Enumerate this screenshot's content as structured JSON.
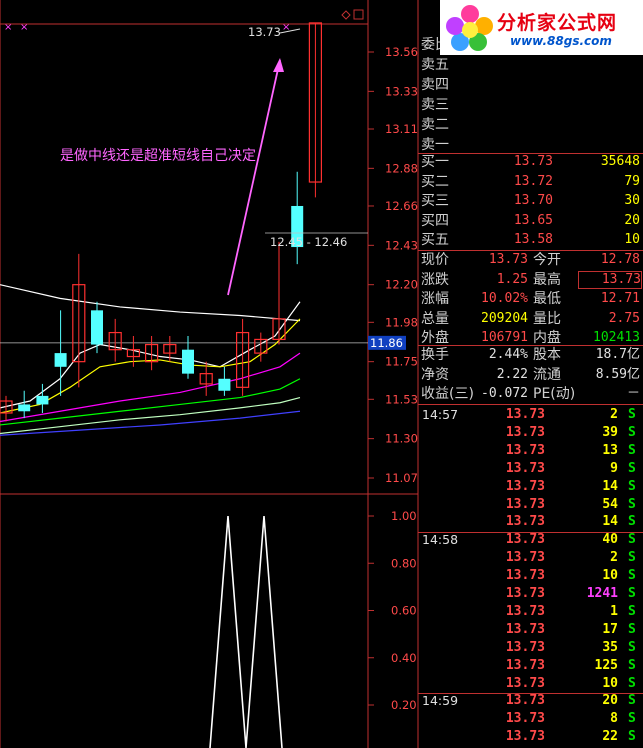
{
  "watermark": {
    "title": "分析家公式网",
    "url": "www.88gs.com"
  },
  "price_axis": [
    "13.56",
    "13.33",
    "13.11",
    "12.88",
    "12.66",
    "12.43",
    "12.20",
    "11.98",
    "11.75",
    "11.53",
    "11.30",
    "11.07"
  ],
  "current_price_tag": "11.86",
  "indicator_axis": [
    "1.00",
    "0.80",
    "0.60",
    "0.40",
    "0.20"
  ],
  "annotation": "是做中线还是超准短线自己决定",
  "high_label": "13.73",
  "range_label": "12.45 - 12.46",
  "order_book": {
    "header": "委比",
    "asks": [
      {
        "label": "卖五",
        "price": "",
        "vol": ""
      },
      {
        "label": "卖四",
        "price": "",
        "vol": ""
      },
      {
        "label": "卖三",
        "price": "",
        "vol": ""
      },
      {
        "label": "卖二",
        "price": "",
        "vol": ""
      },
      {
        "label": "卖一",
        "price": "",
        "vol": ""
      }
    ],
    "bids": [
      {
        "label": "买一",
        "price": "13.73",
        "vol": "35648"
      },
      {
        "label": "买二",
        "price": "13.72",
        "vol": "79"
      },
      {
        "label": "买三",
        "price": "13.70",
        "vol": "30"
      },
      {
        "label": "买四",
        "price": "13.65",
        "vol": "20"
      },
      {
        "label": "买五",
        "price": "13.58",
        "vol": "10"
      }
    ]
  },
  "quote": [
    {
      "l1": "现价",
      "v1": "13.73",
      "c1": "red",
      "l2": "今开",
      "v2": "12.78",
      "c2": "red",
      "box": false
    },
    {
      "l1": "涨跌",
      "v1": "1.25",
      "c1": "red",
      "l2": "最高",
      "v2": "13.73",
      "c2": "red",
      "box": true
    },
    {
      "l1": "涨幅",
      "v1": "10.02%",
      "c1": "red",
      "l2": "最低",
      "v2": "12.71",
      "c2": "red",
      "box": false
    },
    {
      "l1": "总量",
      "v1": "209204",
      "c1": "yellow",
      "l2": "量比",
      "v2": "2.75",
      "c2": "red",
      "box": false
    },
    {
      "l1": "外盘",
      "v1": "106791",
      "c1": "red",
      "l2": "内盘",
      "v2": "102413",
      "c2": "green",
      "box": false
    }
  ],
  "fundamentals": [
    {
      "l1": "换手",
      "v1": "2.44%",
      "l2": "股本",
      "v2": "18.7亿"
    },
    {
      "l1": "净资",
      "v1": "2.22",
      "l2": "流通",
      "v2": "8.59亿"
    },
    {
      "l1": "收益(三)",
      "v1": "-0.072",
      "l2": "PE(动)",
      "v2": "－"
    }
  ],
  "ticks": [
    {
      "time": "14:57",
      "price": "13.73",
      "vol": "2",
      "side": "S",
      "vc": "yellow"
    },
    {
      "time": "",
      "price": "13.73",
      "vol": "39",
      "side": "S",
      "vc": "yellow"
    },
    {
      "time": "",
      "price": "13.73",
      "vol": "13",
      "side": "S",
      "vc": "yellow"
    },
    {
      "time": "",
      "price": "13.73",
      "vol": "9",
      "side": "S",
      "vc": "yellow"
    },
    {
      "time": "",
      "price": "13.73",
      "vol": "14",
      "side": "S",
      "vc": "yellow"
    },
    {
      "time": "",
      "price": "13.73",
      "vol": "54",
      "side": "S",
      "vc": "yellow"
    },
    {
      "time": "",
      "price": "13.73",
      "vol": "14",
      "side": "S",
      "vc": "yellow"
    },
    {
      "time": "14:58",
      "price": "13.73",
      "vol": "40",
      "side": "S",
      "vc": "yellow"
    },
    {
      "time": "",
      "price": "13.73",
      "vol": "2",
      "side": "S",
      "vc": "yellow"
    },
    {
      "time": "",
      "price": "13.73",
      "vol": "10",
      "side": "S",
      "vc": "yellow"
    },
    {
      "time": "",
      "price": "13.73",
      "vol": "1241",
      "side": "S",
      "vc": "magenta"
    },
    {
      "time": "",
      "price": "13.73",
      "vol": "1",
      "side": "S",
      "vc": "yellow"
    },
    {
      "time": "",
      "price": "13.73",
      "vol": "17",
      "side": "S",
      "vc": "yellow"
    },
    {
      "time": "",
      "price": "13.73",
      "vol": "35",
      "side": "S",
      "vc": "yellow"
    },
    {
      "time": "",
      "price": "13.73",
      "vol": "125",
      "side": "S",
      "vc": "yellow"
    },
    {
      "time": "",
      "price": "13.73",
      "vol": "10",
      "side": "S",
      "vc": "yellow"
    },
    {
      "time": "14:59",
      "price": "13.73",
      "vol": "20",
      "side": "S",
      "vc": "yellow"
    },
    {
      "time": "",
      "price": "13.73",
      "vol": "8",
      "side": "S",
      "vc": "yellow"
    },
    {
      "time": "",
      "price": "13.73",
      "vol": "22",
      "side": "S",
      "vc": "yellow"
    }
  ],
  "candles": [
    {
      "o": 11.45,
      "c": 11.52,
      "h": 11.55,
      "l": 11.4
    },
    {
      "o": 11.5,
      "c": 11.46,
      "h": 11.58,
      "l": 11.42
    },
    {
      "o": 11.55,
      "c": 11.5,
      "h": 11.62,
      "l": 11.45
    },
    {
      "o": 11.8,
      "c": 11.72,
      "h": 12.05,
      "l": 11.55
    },
    {
      "o": 11.75,
      "c": 12.2,
      "h": 12.38,
      "l": 11.6
    },
    {
      "o": 12.05,
      "c": 11.85,
      "h": 12.1,
      "l": 11.8
    },
    {
      "o": 11.82,
      "c": 11.92,
      "h": 12.0,
      "l": 11.75
    },
    {
      "o": 11.78,
      "c": 11.82,
      "h": 11.9,
      "l": 11.72
    },
    {
      "o": 11.75,
      "c": 11.85,
      "h": 11.9,
      "l": 11.7
    },
    {
      "o": 11.8,
      "c": 11.85,
      "h": 11.9,
      "l": 11.75
    },
    {
      "o": 11.82,
      "c": 11.68,
      "h": 11.9,
      "l": 11.65
    },
    {
      "o": 11.62,
      "c": 11.68,
      "h": 11.75,
      "l": 11.55
    },
    {
      "o": 11.65,
      "c": 11.58,
      "h": 11.72,
      "l": 11.55
    },
    {
      "o": 11.6,
      "c": 11.92,
      "h": 12.0,
      "l": 11.55
    },
    {
      "o": 11.8,
      "c": 11.88,
      "h": 11.92,
      "l": 11.75
    },
    {
      "o": 11.88,
      "c": 12.0,
      "h": 12.45,
      "l": 11.85
    },
    {
      "o": 12.66,
      "c": 12.42,
      "h": 12.86,
      "l": 12.32
    },
    {
      "o": 12.8,
      "c": 13.73,
      "h": 13.73,
      "l": 12.71
    }
  ],
  "candle_colors": {
    "up": "#ff3030",
    "down": "#54ffff"
  },
  "colors": {
    "accent_red": "#c03030",
    "ma_white": "#ffffff",
    "ma_yellow": "#ffff00",
    "ma_magenta": "#ff00ff",
    "ma_green": "#00ff00",
    "ma_blue": "#4040ff"
  }
}
